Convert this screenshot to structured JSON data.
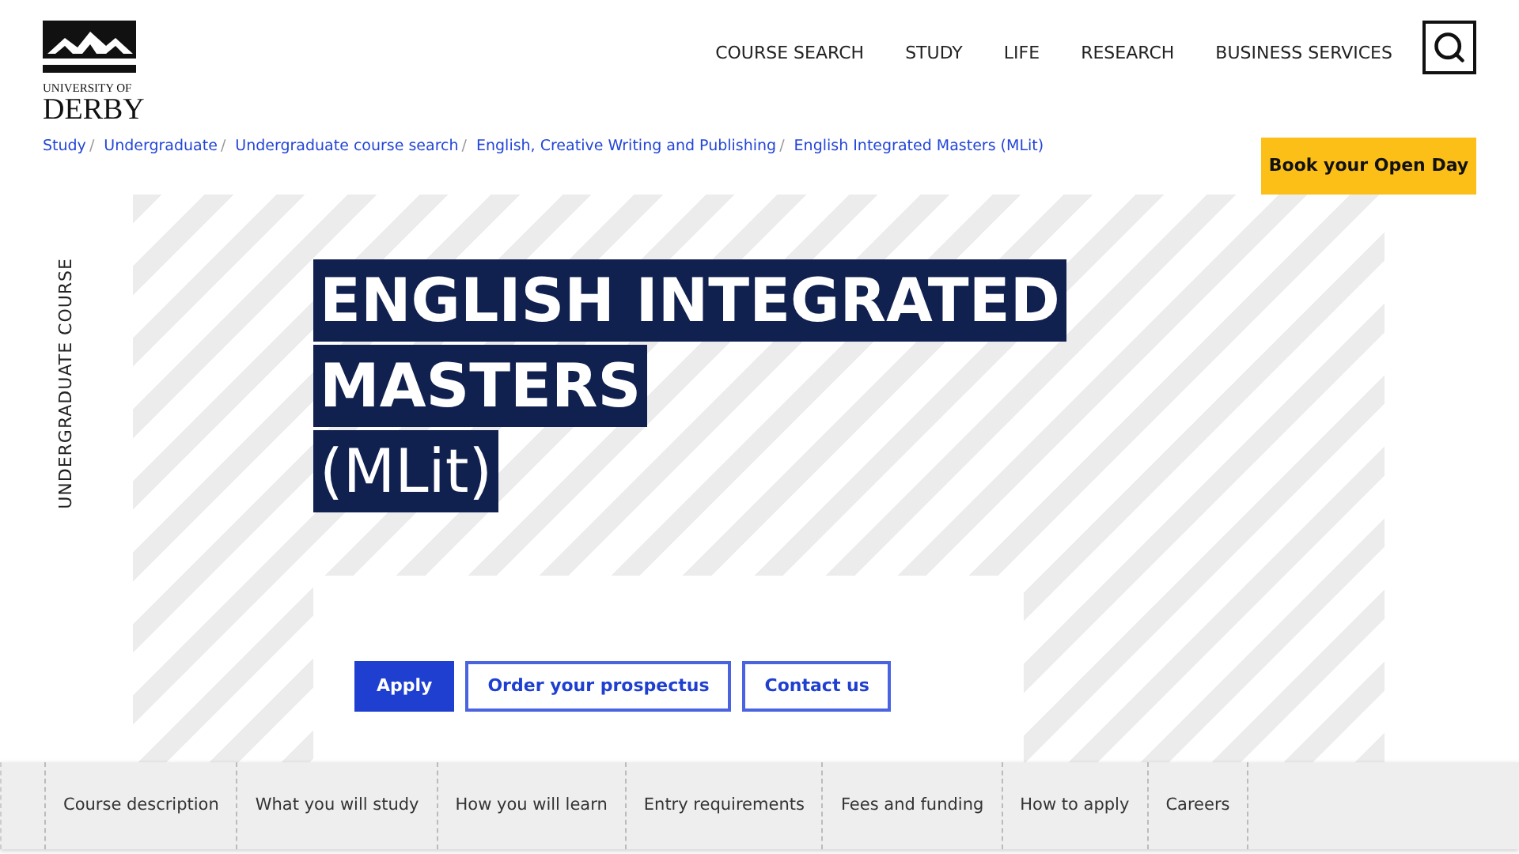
{
  "logo": {
    "line_1": "UNIVERSITY OF",
    "line_2": "DERBY"
  },
  "nav": [
    "COURSE SEARCH",
    "STUDY",
    "LIFE",
    "RESEARCH",
    "BUSINESS SERVICES"
  ],
  "breadcrumbs": [
    {
      "label": "Study",
      "separator": "/"
    },
    {
      "label": "Undergraduate",
      "separator": "/"
    },
    {
      "label": "Undergraduate course search",
      "separator": "/"
    },
    {
      "label": "English, Creative Writing and Publishing",
      "separator": "/"
    },
    {
      "label": "English Integrated Masters (MLit)"
    }
  ],
  "open_day_button": "Book your Open Day",
  "side_label": "UNDERGRADUATE COURSE",
  "title_lines": [
    {
      "text": "ENGLISH INTEGRATED",
      "bold": true
    },
    {
      "text": "MASTERS",
      "bold": true
    },
    {
      "text": "(MLit)",
      "bold": false
    }
  ],
  "actions": [
    {
      "label": "Apply",
      "kind": "primary"
    },
    {
      "label": "Order your prospectus",
      "kind": "outline"
    },
    {
      "label": "Contact us",
      "kind": "outline"
    }
  ],
  "section_tabs": [
    "Course description",
    "What you will study",
    "How you will learn",
    "Entry requirements",
    "Fees and funding",
    "How to apply",
    "Careers"
  ]
}
